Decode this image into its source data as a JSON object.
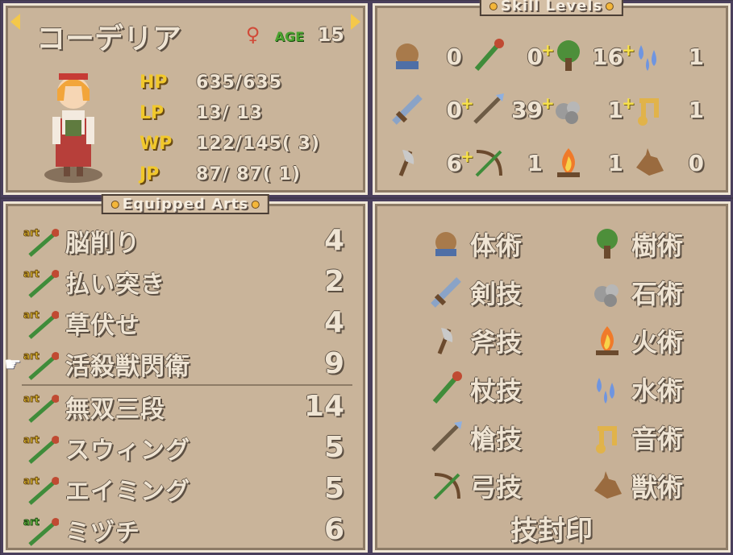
{
  "character": {
    "name": "コーデリア",
    "age_label": "AGE",
    "age": "15",
    "hp_label": "HP",
    "hp": "635/635",
    "lp_label": "LP",
    "lp": "13/ 13",
    "wp_label": "WP",
    "wp": "122/145( 3)",
    "jp_label": "JP",
    "jp": "87/ 87( 1)"
  },
  "skill_levels": {
    "title": "Skill Levels",
    "cells": [
      {
        "icon": "fist-icon",
        "value": "0"
      },
      {
        "icon": "staff-icon",
        "value": "0"
      },
      {
        "icon": "tree-icon",
        "value": "16",
        "plus": "+"
      },
      {
        "icon": "water-icon",
        "value": "1",
        "plus": "+"
      },
      {
        "icon": "sword-icon",
        "value": "0"
      },
      {
        "icon": "spear-icon",
        "value": "39",
        "plus": "+"
      },
      {
        "icon": "stone-icon",
        "value": "1",
        "plus": "+"
      },
      {
        "icon": "music-icon",
        "value": "1",
        "plus": "+"
      },
      {
        "icon": "axe-icon",
        "value": "6"
      },
      {
        "icon": "bow-icon",
        "value": "1",
        "plus": "+"
      },
      {
        "icon": "fire-icon",
        "value": "1"
      },
      {
        "icon": "beast-icon",
        "value": "0"
      }
    ]
  },
  "equipped_arts": {
    "title": "Equipped Arts",
    "items": [
      {
        "name": "脳削り",
        "value": "4",
        "icon_color": "#f1c82c"
      },
      {
        "name": "払い突き",
        "value": "2",
        "icon_color": "#f1c82c"
      },
      {
        "name": "草伏せ",
        "value": "4",
        "icon_color": "#f1c82c"
      },
      {
        "name": "活殺獣閃衛",
        "value": "9",
        "icon_color": "#f1c82c"
      },
      {
        "name": "無双三段",
        "value": "14",
        "icon_color": "#f1c82c"
      },
      {
        "name": "スウィング",
        "value": "5",
        "icon_color": "#f1c82c"
      },
      {
        "name": "エイミング",
        "value": "5",
        "icon_color": "#f1c82c"
      },
      {
        "name": "ミヅチ",
        "value": "6",
        "icon_color": "#74d04a"
      }
    ]
  },
  "skill_types": {
    "left": [
      "体術",
      "剣技",
      "斧技",
      "杖技",
      "槍技",
      "弓技"
    ],
    "right": [
      "樹術",
      "石術",
      "火術",
      "水術",
      "音術",
      "獣術"
    ],
    "seal": "技封印"
  }
}
